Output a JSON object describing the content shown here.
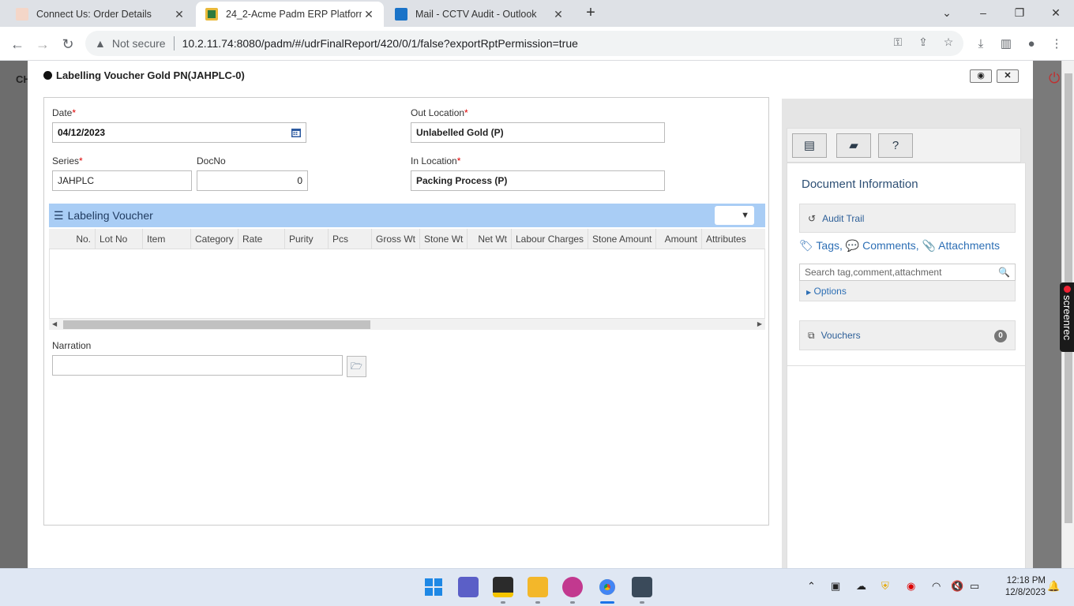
{
  "browser": {
    "tabs": [
      {
        "title": "Connect Us: Order Details",
        "active": false
      },
      {
        "title": "24_2-Acme Padm ERP Platform",
        "active": true
      },
      {
        "title": "Mail - CCTV Audit - Outlook",
        "active": false
      }
    ],
    "security_label": "Not secure",
    "url": "10.2.11.74:8080/padm/#/udrFinalReport/420/0/1/false?exportRptPermission=true"
  },
  "background_app": {
    "header_text": "CH"
  },
  "modal": {
    "title": "Labelling Voucher Gold PN(JAHPLC-0)",
    "form": {
      "date_label": "Date",
      "date_value": "04/12/2023",
      "out_location_label": "Out Location",
      "out_location_value": "Unlabelled Gold (P)",
      "series_label": "Series",
      "series_value": "JAHPLC",
      "docno_label": "DocNo",
      "docno_value": "0",
      "in_location_label": "In Location",
      "in_location_value": "Packing Process (P)",
      "required_mark": "*"
    },
    "grid": {
      "title": "Labeling Voucher",
      "columns": [
        "No.",
        "Lot No",
        "Item",
        "Category",
        "Rate",
        "Purity",
        "Pcs",
        "Gross Wt",
        "Stone Wt",
        "Net Wt",
        "Labour Charges",
        "Stone Amount",
        "Amount",
        "Attributes"
      ]
    },
    "narration": {
      "label": "Narration",
      "value": ""
    }
  },
  "side_panel": {
    "document_information": "Document Information",
    "audit_trail": "Audit Trail",
    "tags": "Tags,",
    "comments": "Comments,",
    "attachments": "Attachments",
    "search_placeholder": "Search tag,comment,attachment",
    "options": "Options",
    "vouchers": "Vouchers",
    "vouchers_count": "0"
  },
  "screenrec_label": "screenrec",
  "taskbar": {
    "time": "12:18 PM",
    "date": "12/8/2023"
  }
}
